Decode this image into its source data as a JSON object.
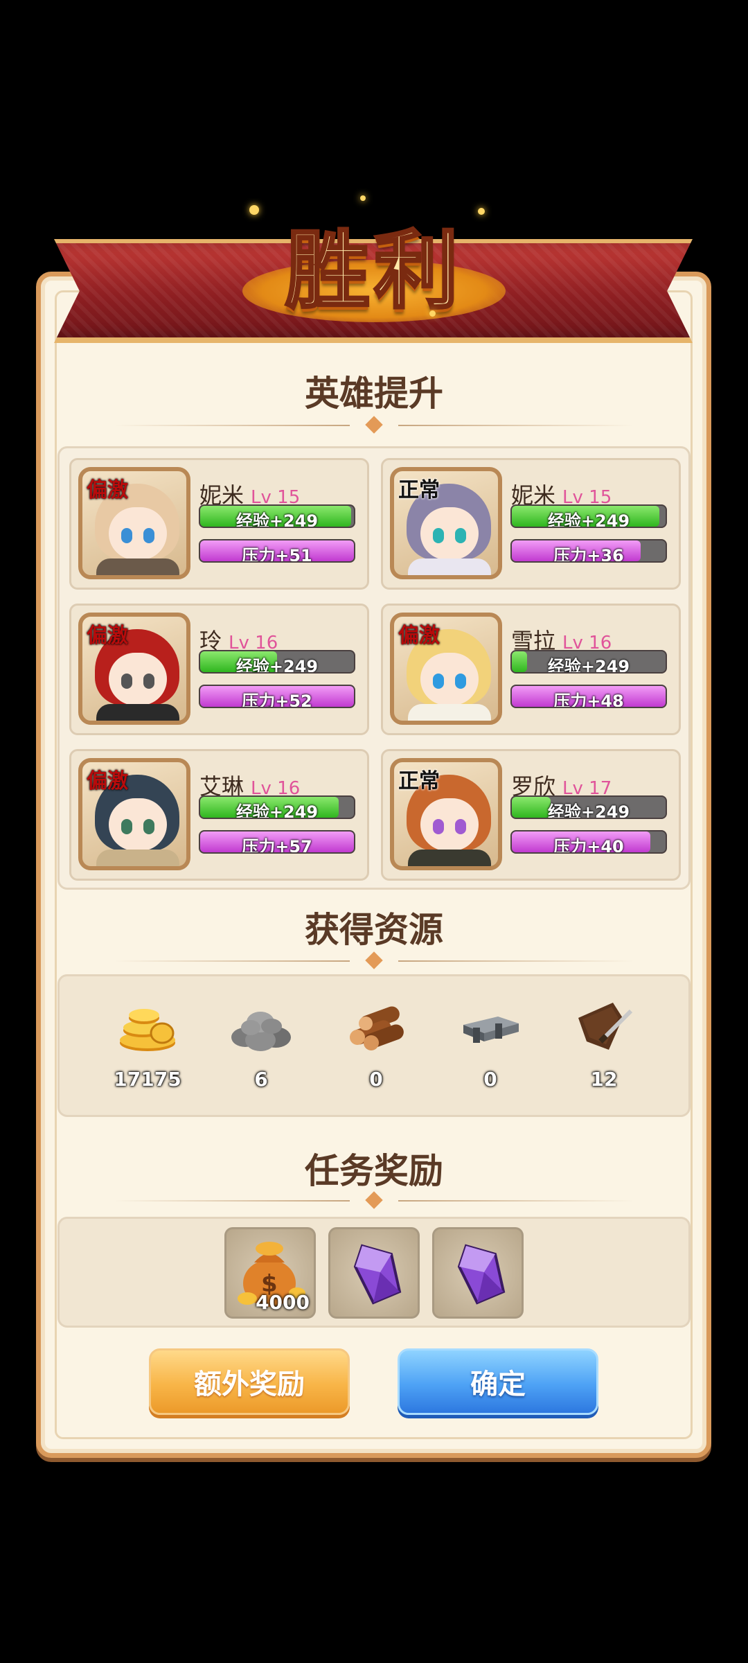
{
  "title": "胜利",
  "sections": {
    "heroes": "英雄提升",
    "resources": "获得资源",
    "missions": "任务奖励"
  },
  "heroes": [
    {
      "status": "偏激",
      "name": "妮米",
      "level": "Lv 15",
      "exp": "经验+249",
      "stress": "压力+51",
      "exp_fill": 0.98,
      "stress_fill": 1.0
    },
    {
      "status": "正常",
      "name": "妮米",
      "level": "Lv 15",
      "exp": "经验+249",
      "stress": "压力+36",
      "exp_fill": 0.96,
      "stress_fill": 0.84
    },
    {
      "status": "偏激",
      "name": "玲",
      "level": "Lv 16",
      "exp": "经验+249",
      "stress": "压力+52",
      "exp_fill": 0.5,
      "stress_fill": 1.0
    },
    {
      "status": "偏激",
      "name": "雪拉",
      "level": "Lv 16",
      "exp": "经验+249",
      "stress": "压力+48",
      "exp_fill": 0.1,
      "stress_fill": 1.0
    },
    {
      "status": "偏激",
      "name": "艾琳",
      "level": "Lv 16",
      "exp": "经验+249",
      "stress": "压力+57",
      "exp_fill": 0.9,
      "stress_fill": 1.0
    },
    {
      "status": "正常",
      "name": "罗欣",
      "level": "Lv 17",
      "exp": "经验+249",
      "stress": "压力+40",
      "exp_fill": 0.25,
      "stress_fill": 0.9
    }
  ],
  "resources": [
    {
      "icon": "gold-coins-icon",
      "count": "17175"
    },
    {
      "icon": "stone-icon",
      "count": "6"
    },
    {
      "icon": "wood-logs-icon",
      "count": "0"
    },
    {
      "icon": "iron-ingot-icon",
      "count": "0"
    },
    {
      "icon": "leather-icon",
      "count": "12"
    }
  ],
  "mission_rewards": [
    {
      "icon": "money-bag-icon",
      "count": "4000"
    },
    {
      "icon": "purple-crystal-icon",
      "count": ""
    },
    {
      "icon": "purple-crystal-icon",
      "count": ""
    }
  ],
  "buttons": {
    "extra": "额外奖励",
    "confirm": "确定"
  },
  "colors": {
    "exp_bar": "#2fb61f",
    "stress_bar": "#c13ad0",
    "level_text": "#e0549a",
    "status_extreme": "#b80b0b",
    "confirm_button": "#4ea2f5",
    "extra_button": "#f8b548"
  }
}
